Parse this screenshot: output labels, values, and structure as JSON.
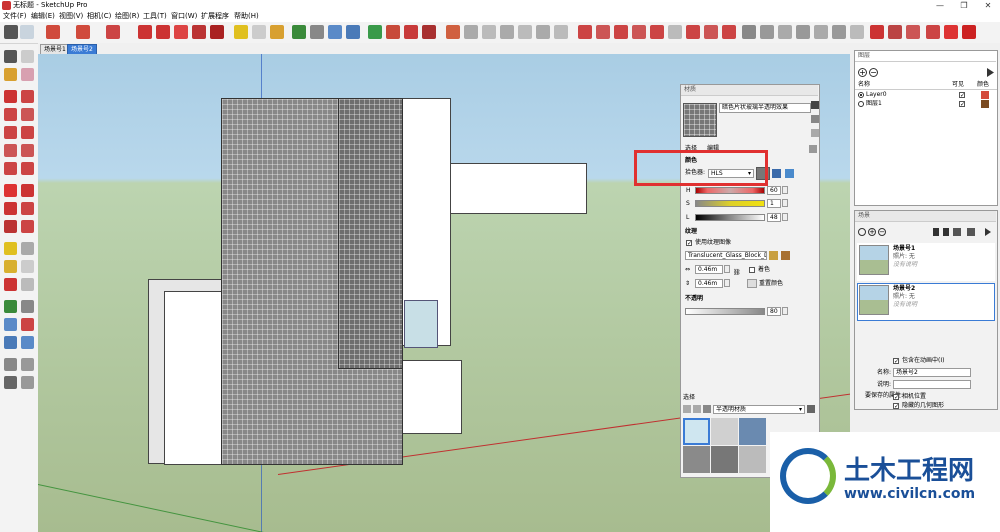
{
  "window": {
    "title": "无标题 - SketchUp Pro",
    "min": "—",
    "max": "❐",
    "close": "✕"
  },
  "menu": [
    "文件(F)",
    "编辑(E)",
    "视图(V)",
    "相机(C)",
    "绘图(R)",
    "工具(T)",
    "窗口(W)",
    "扩展程序",
    "帮助(H)"
  ],
  "scene_tabs": [
    "场景号1",
    "场景号2"
  ],
  "materials": {
    "title": "材质",
    "material_name": "暗色片状玻璃半透明效果",
    "tabs": [
      "选择",
      "编辑"
    ],
    "color_section": "颜色",
    "picker_label": "拾色器:",
    "picker_value": "HLS",
    "h_label": "H",
    "h_value": "60",
    "s_label": "S",
    "s_value": "1",
    "l_label": "L",
    "l_value": "48",
    "texture_section": "纹理",
    "use_texture": "使用纹理图像",
    "texture_file": "Translucent_Glass_Block_Dark..",
    "width_value": "0.46m",
    "height_value": "0.46m",
    "colorize": "着色",
    "reset_color": "重置颜色",
    "opacity_section": "不透明",
    "opacity_value": "80",
    "select_section": "选择",
    "library_value": "半透明材质"
  },
  "layers": {
    "title": "图层",
    "col_name": "名称",
    "col_visible": "可见",
    "col_color": "颜色",
    "rows": [
      {
        "name": "Layer0",
        "color": "#d44a3c"
      },
      {
        "name": "图层1",
        "color": "#7a4a20"
      }
    ]
  },
  "scenes": {
    "title": "场景",
    "items": [
      {
        "name": "场景号1",
        "photo": "照片: 无",
        "desc": "没有说明"
      },
      {
        "name": "场景号2",
        "photo": "照片: 无",
        "desc": "没有说明"
      }
    ],
    "include_animation": "包含在动画中(I)",
    "name_label": "名称:",
    "name_value": "场景号2",
    "desc_label": "说明:",
    "save_props": "要保存的属性:",
    "camera_pos": "相机位置",
    "hidden_geom": "隐藏的几何图形"
  },
  "watermark": {
    "brand": "土木工程网",
    "url": "www.civilcn.com"
  }
}
